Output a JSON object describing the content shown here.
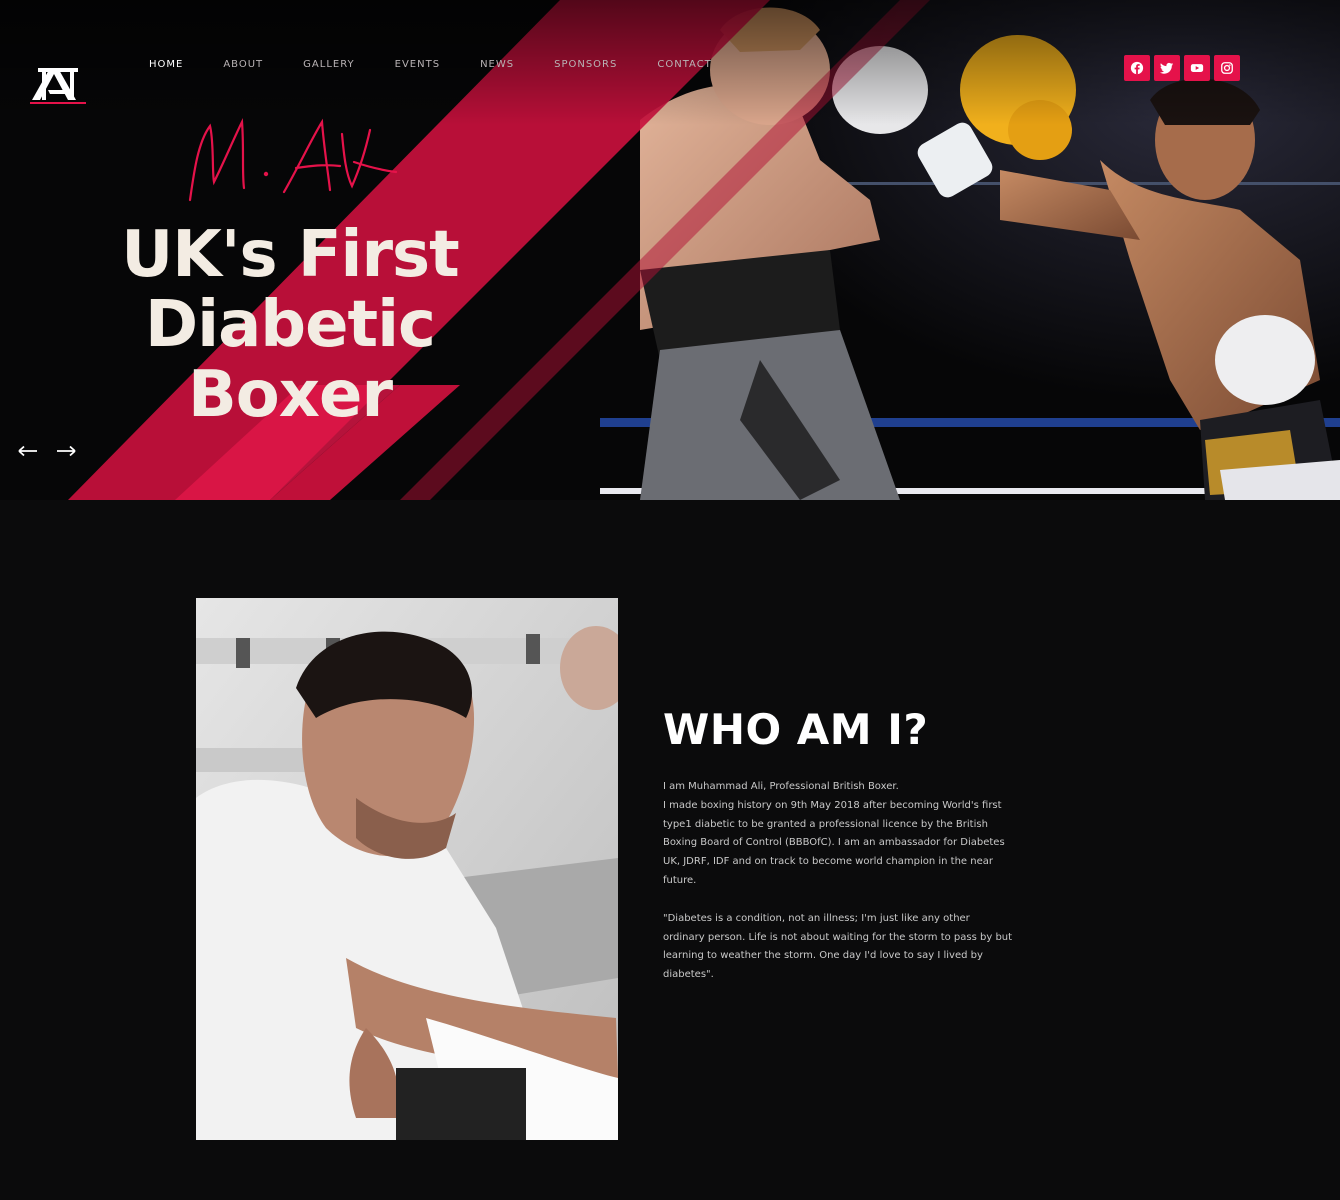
{
  "nav": {
    "items": [
      {
        "label": "HOME",
        "active": true
      },
      {
        "label": "ABOUT",
        "active": false
      },
      {
        "label": "GALLERY",
        "active": false
      },
      {
        "label": "EVENTS",
        "active": false
      },
      {
        "label": "NEWS",
        "active": false
      },
      {
        "label": "SPONSORS",
        "active": false
      },
      {
        "label": "CONTACT",
        "active": false
      }
    ]
  },
  "social": {
    "icons": [
      "facebook-icon",
      "twitter-icon",
      "youtube-icon",
      "instagram-icon"
    ]
  },
  "hero": {
    "signature": "M. Ali",
    "title_line1": "UK's First",
    "title_line2": "Diabetic Boxer"
  },
  "about": {
    "heading": "WHO AM I?",
    "intro": "I am Muhammad Ali, Professional British Boxer.",
    "history": "I made boxing history on 9th May 2018 after becoming World's first type1 diabetic to be granted a professional licence by the British Boxing Board of Control (BBBOfC). I am an ambassador for Diabetes UK, JDRF, IDF and on track to become world champion in the near future.",
    "quote": "\"Diabetes is a condition, not an illness; I'm just like any other ordinary person. Life is not about waiting for the storm to pass by but learning to weather the storm. One day I'd love to say I lived by diabetes\"."
  },
  "colors": {
    "accent": "#e5124a",
    "background": "#0b0b0c",
    "title": "#f3ece3"
  }
}
